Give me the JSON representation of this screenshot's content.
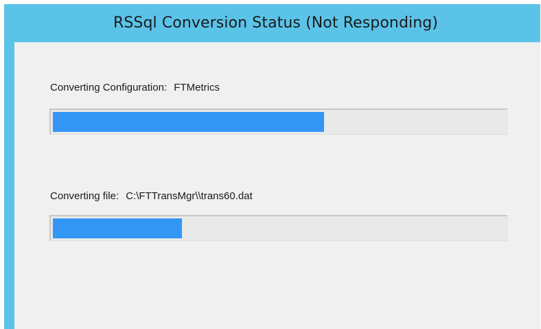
{
  "window": {
    "title": "RSSql Conversion Status (Not Responding)"
  },
  "config_status": {
    "label": "Converting Configuration:",
    "value": "FTMetrics",
    "progress": 0.6
  },
  "file_status": {
    "label": "Converting file:",
    "value": "C:\\FTTransMgr\\\\trans60.dat",
    "progress": 0.285
  },
  "colors": {
    "title_bar": "#5bc3e8",
    "client_background": "#f0f0f0",
    "progress_fill": "#3396f5",
    "progress_track": "#e9e9e9"
  }
}
